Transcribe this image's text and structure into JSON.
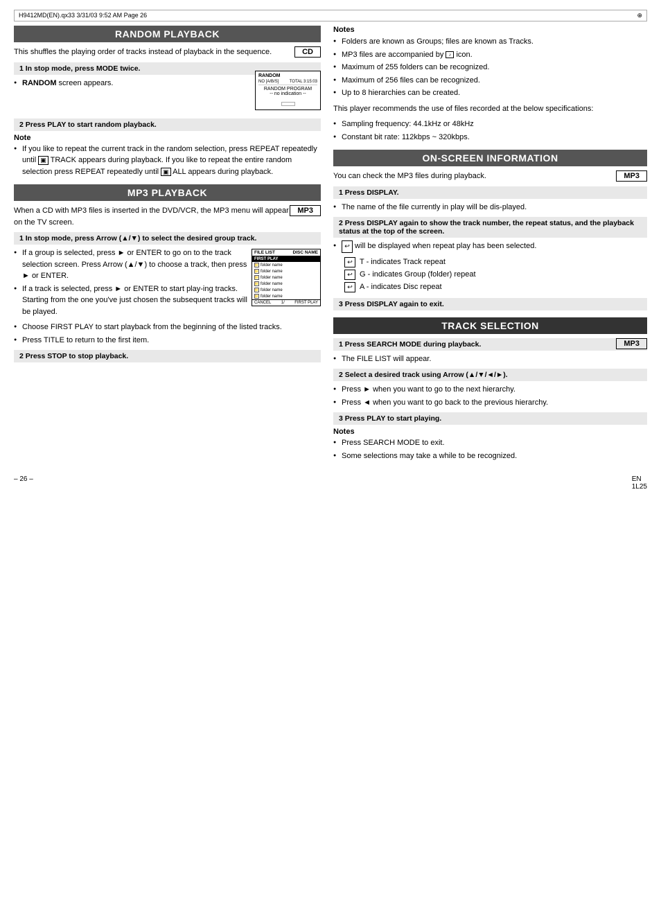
{
  "topbar": {
    "left": "H9412MD(EN).qx33   3/31/03  9:52 AM   Page 26",
    "crosshair": "⊕"
  },
  "left_column": {
    "section1": {
      "title": "RANDOM PLAYBACK",
      "badge": "CD",
      "intro": "This  shuffles  the  playing  order  of  tracks  instead  of playback in the sequence.",
      "step1": {
        "label": "1   In stop mode, press MODE twice.",
        "bullets": [
          "RANDOM screen appears."
        ]
      },
      "step2": {
        "label": "2   Press PLAY to start random playback."
      },
      "note_label": "Note",
      "note_bullets": [
        "If you like to repeat the current track in the random selection,  press  REPEAT  repeatedly  until  ▣ TRACK appears during playback. If you like to repeat the entire random selection press REPEAT repeatedly until ▣ ALL appears during playback."
      ]
    },
    "section2": {
      "title": "MP3 PLAYBACK",
      "badge": "MP3",
      "intro": "When  a  CD  with  MP3  files  is  inserted  in  the DVD/VCR,  the  MP3  menu  will  appear  on  the  TV screen.",
      "step1": {
        "label": "1   In stop mode, press Arrow (▲/▼) to select the desired group track."
      },
      "step1_bullets": [
        "If a group is selected, press ► or ENTER to go on to the track selection screen. Press  Arrow  (▲/▼)  to choose a track, then press ► or ENTER.",
        "If a track is selected, press ► or ENTER to start play-ing tracks. Starting from the one you've just chosen the subsequent tracks will be played.",
        "Choose  FIRST PLAY  to  start  playback  from  the beginning of the listed tracks.",
        "Press TITLE to return to the first item."
      ],
      "step2": {
        "label": "2   Press STOP to stop playback."
      },
      "file_list": {
        "header_left": "FILE LIST",
        "header_right": "DISC NAME",
        "rows": [
          {
            "icon": "📁",
            "label": "folder name",
            "selected": false
          },
          {
            "icon": "📁",
            "label": "folder name",
            "selected": false
          },
          {
            "icon": "📁",
            "label": "folder name",
            "selected": false
          },
          {
            "icon": "📁",
            "label": "folder name",
            "selected": false
          },
          {
            "icon": "📁",
            "label": "folder name",
            "selected": false
          },
          {
            "icon": "📁",
            "label": "folder name",
            "selected": false
          }
        ],
        "footer_left": "CANCEL",
        "footer_middle": "1/",
        "footer_right": "FIRST PLAY"
      }
    }
  },
  "right_column": {
    "notes_section": {
      "title": "Notes",
      "bullets": [
        "Folders  are  known  as  Groups;  files  are  known  as Tracks.",
        "MP3 files are accompanied by  🎵  icon.",
        "Maximum of 255 folders can be recognized.",
        "Maximum of 256 files can be recognized.",
        "Up to 8 hierarchies can be created.",
        "This  player  recommends  the  use  of  files  recorded  at the below specifications:",
        "Sampling frequency: 44.1kHz or 48kHz",
        "Constant bit rate: 112kbps ~ 320kbps."
      ]
    },
    "section_onscreen": {
      "title": "ON-SCREEN INFORMATION",
      "badge": "MP3",
      "intro": "You can check the MP3 files during playback.",
      "step1": {
        "label": "1   Press DISPLAY."
      },
      "step1_bullets": [
        "The name of the file currently in play will be dis-played."
      ],
      "step2": {
        "label": "2   Press DISPLAY again to show the track number, the repeat status, and the playback status at the top of the screen."
      },
      "step2_bullets": [
        "↩  will be displayed when repeat play has been selected."
      ],
      "repeat_rows": [
        {
          "icon": "↩",
          "label": "T - indicates Track repeat"
        },
        {
          "icon": "↩",
          "label": "G - indicates Group (folder) repeat"
        },
        {
          "icon": "↩",
          "label": "A - indicates Disc repeat"
        }
      ],
      "step3": {
        "label": "3   Press DISPLAY again to exit."
      }
    },
    "section_track": {
      "title": "TRACK SELECTION",
      "badge": "MP3",
      "step1": {
        "label": "1   Press SEARCH MODE during playback."
      },
      "step1_bullets": [
        "The FILE LIST will appear."
      ],
      "step2": {
        "label": "2   Select a desired track using Arrow (▲/▼/◄/►)."
      },
      "step2_bullets": [
        "Press ► when you want to go to the next hierarchy.",
        "Press ◄ when you want to go back to the previous hierarchy."
      ],
      "step3": {
        "label": "3   Press PLAY to start playing."
      },
      "notes_label": "Notes",
      "notes_bullets": [
        "Press SEARCH MODE to exit.",
        "Some selections may take a while to be recognized."
      ]
    }
  },
  "footer": {
    "left": "– 26 –",
    "right": "EN\n1L25"
  }
}
